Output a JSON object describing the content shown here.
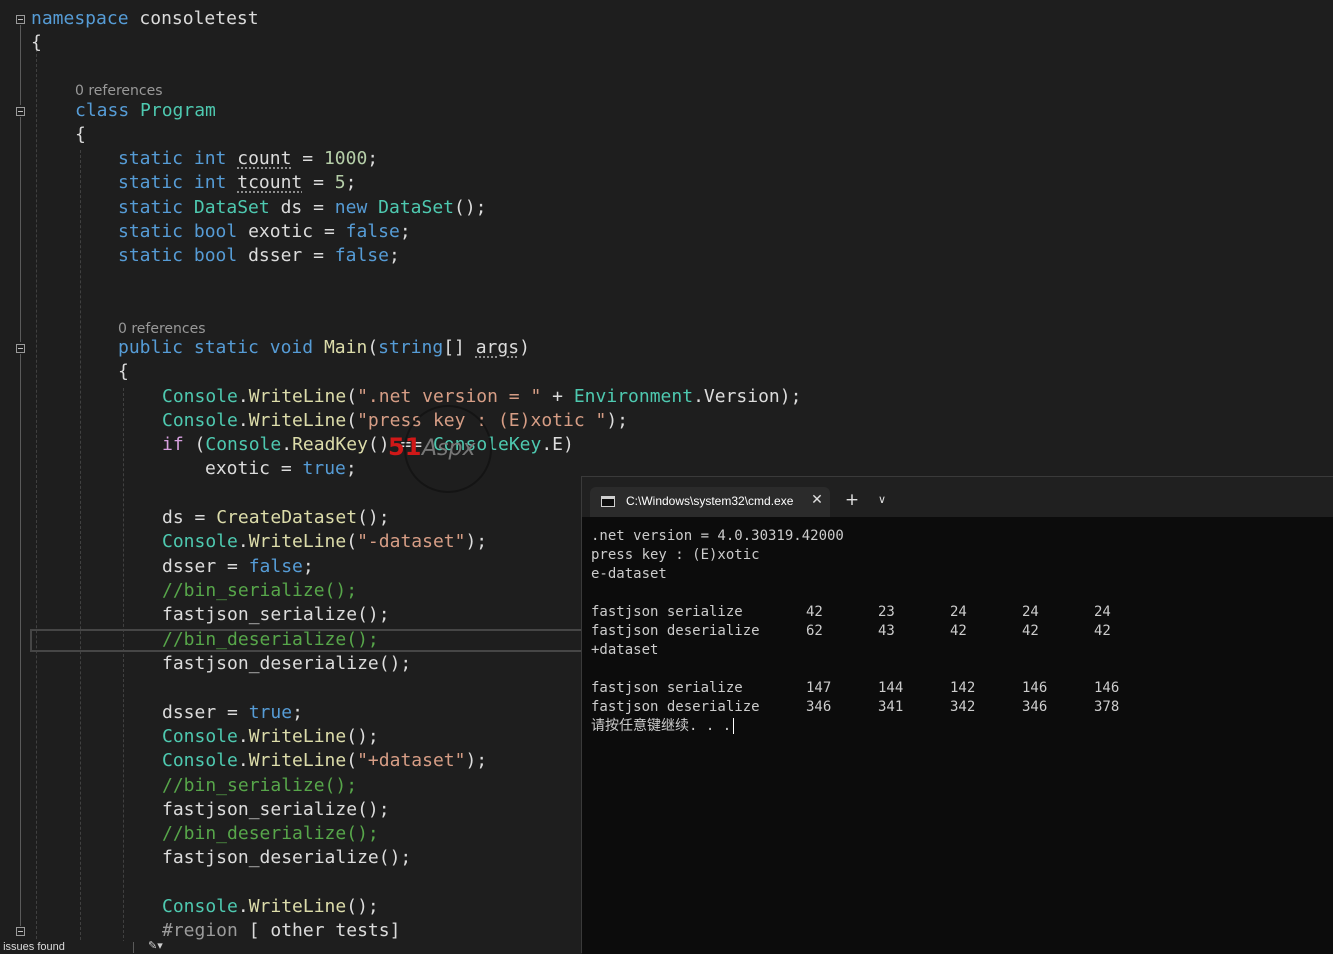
{
  "editor": {
    "namespace_kw": "namespace",
    "namespace_name": "consoletest",
    "open_brace": "{",
    "class_refs": "0 references",
    "class_kw": "class",
    "class_name": "Program",
    "main_refs": "0 references",
    "fields": [
      {
        "mod": "static",
        "type": "int",
        "rest_name": "count",
        "rest_eq": " = ",
        "value": "1000",
        "end": ";"
      },
      {
        "mod": "static",
        "type": "int",
        "rest_name": "tcount",
        "rest_eq": " = ",
        "value": "5",
        "end": ";"
      },
      {
        "mod": "static",
        "type": "DataSet",
        "rest_name": "ds",
        "rest_eq": " = ",
        "new": "new",
        "ctor": "DataSet",
        "end": "();"
      },
      {
        "mod": "static",
        "type": "bool",
        "rest_name": "exotic",
        "rest_eq": " = ",
        "kwval": "false",
        "end": ";"
      },
      {
        "mod": "static",
        "type": "bool",
        "rest_name": "dsser",
        "rest_eq": " = ",
        "kwval": "false",
        "end": ";"
      }
    ],
    "main_sig": {
      "public": "public",
      "static": "static",
      "void": "void",
      "name": "Main",
      "paren": "(",
      "argtype": "string",
      "brackets": "[] ",
      "arg": "args",
      "close": ")"
    },
    "console": "Console",
    "dot": ".",
    "writeline": "WriteLine",
    "environment": "Environment",
    "version": ".Version);",
    "str_net_version": "\".net version = \"",
    "str_press_key": "\"press key : (E)xotic \"",
    "if_kw": "if",
    "readkey_line": "ReadKey() == ConsoleKey.E)",
    "consolekey": "ConsoleKey",
    "exotic_assign": "exotic = ",
    "true_kw": "true",
    "false_kw": "false",
    "ds_assign": "ds = ",
    "create_dataset": "CreateDataset",
    "str_minus_dataset": "\"-dataset\"",
    "str_plus_dataset": "\"+dataset\"",
    "dsser_assign": "dsser = ",
    "comment_bin_serialize": "//bin_serialize();",
    "comment_bin_deserialize": "//bin_deserialize();",
    "fastjson_serialize": "fastjson_serialize();",
    "fastjson_deserialize": "fastjson_deserialize();",
    "region_kw": "#region",
    "region_name": " [ other tests]"
  },
  "status": {
    "issues": "No issues found"
  },
  "terminal": {
    "tab_title": "C:\\Windows\\system32\\cmd.exe",
    "close_icon": "close-icon",
    "new_tab": "+",
    "dropdown": "chevron-down-icon",
    "lines": [
      ".net version = 4.0.30319.42000",
      "press key : (E)xotic",
      "e-dataset"
    ],
    "rows_minus": [
      {
        "label": "fastjson serialize",
        "values": [
          "42",
          "23",
          "24",
          "24",
          "24"
        ]
      },
      {
        "label": "fastjson deserialize",
        "values": [
          "62",
          "43",
          "42",
          "42",
          "42"
        ]
      }
    ],
    "plus_label": "+dataset",
    "rows_plus": [
      {
        "label": "fastjson serialize",
        "values": [
          "147",
          "144",
          "142",
          "146",
          "146"
        ]
      },
      {
        "label": "fastjson deserialize",
        "values": [
          "346",
          "341",
          "342",
          "346",
          "378"
        ]
      }
    ],
    "prompt": "请按任意键继续. . ."
  },
  "watermark": {
    "text": "51Aspx"
  }
}
